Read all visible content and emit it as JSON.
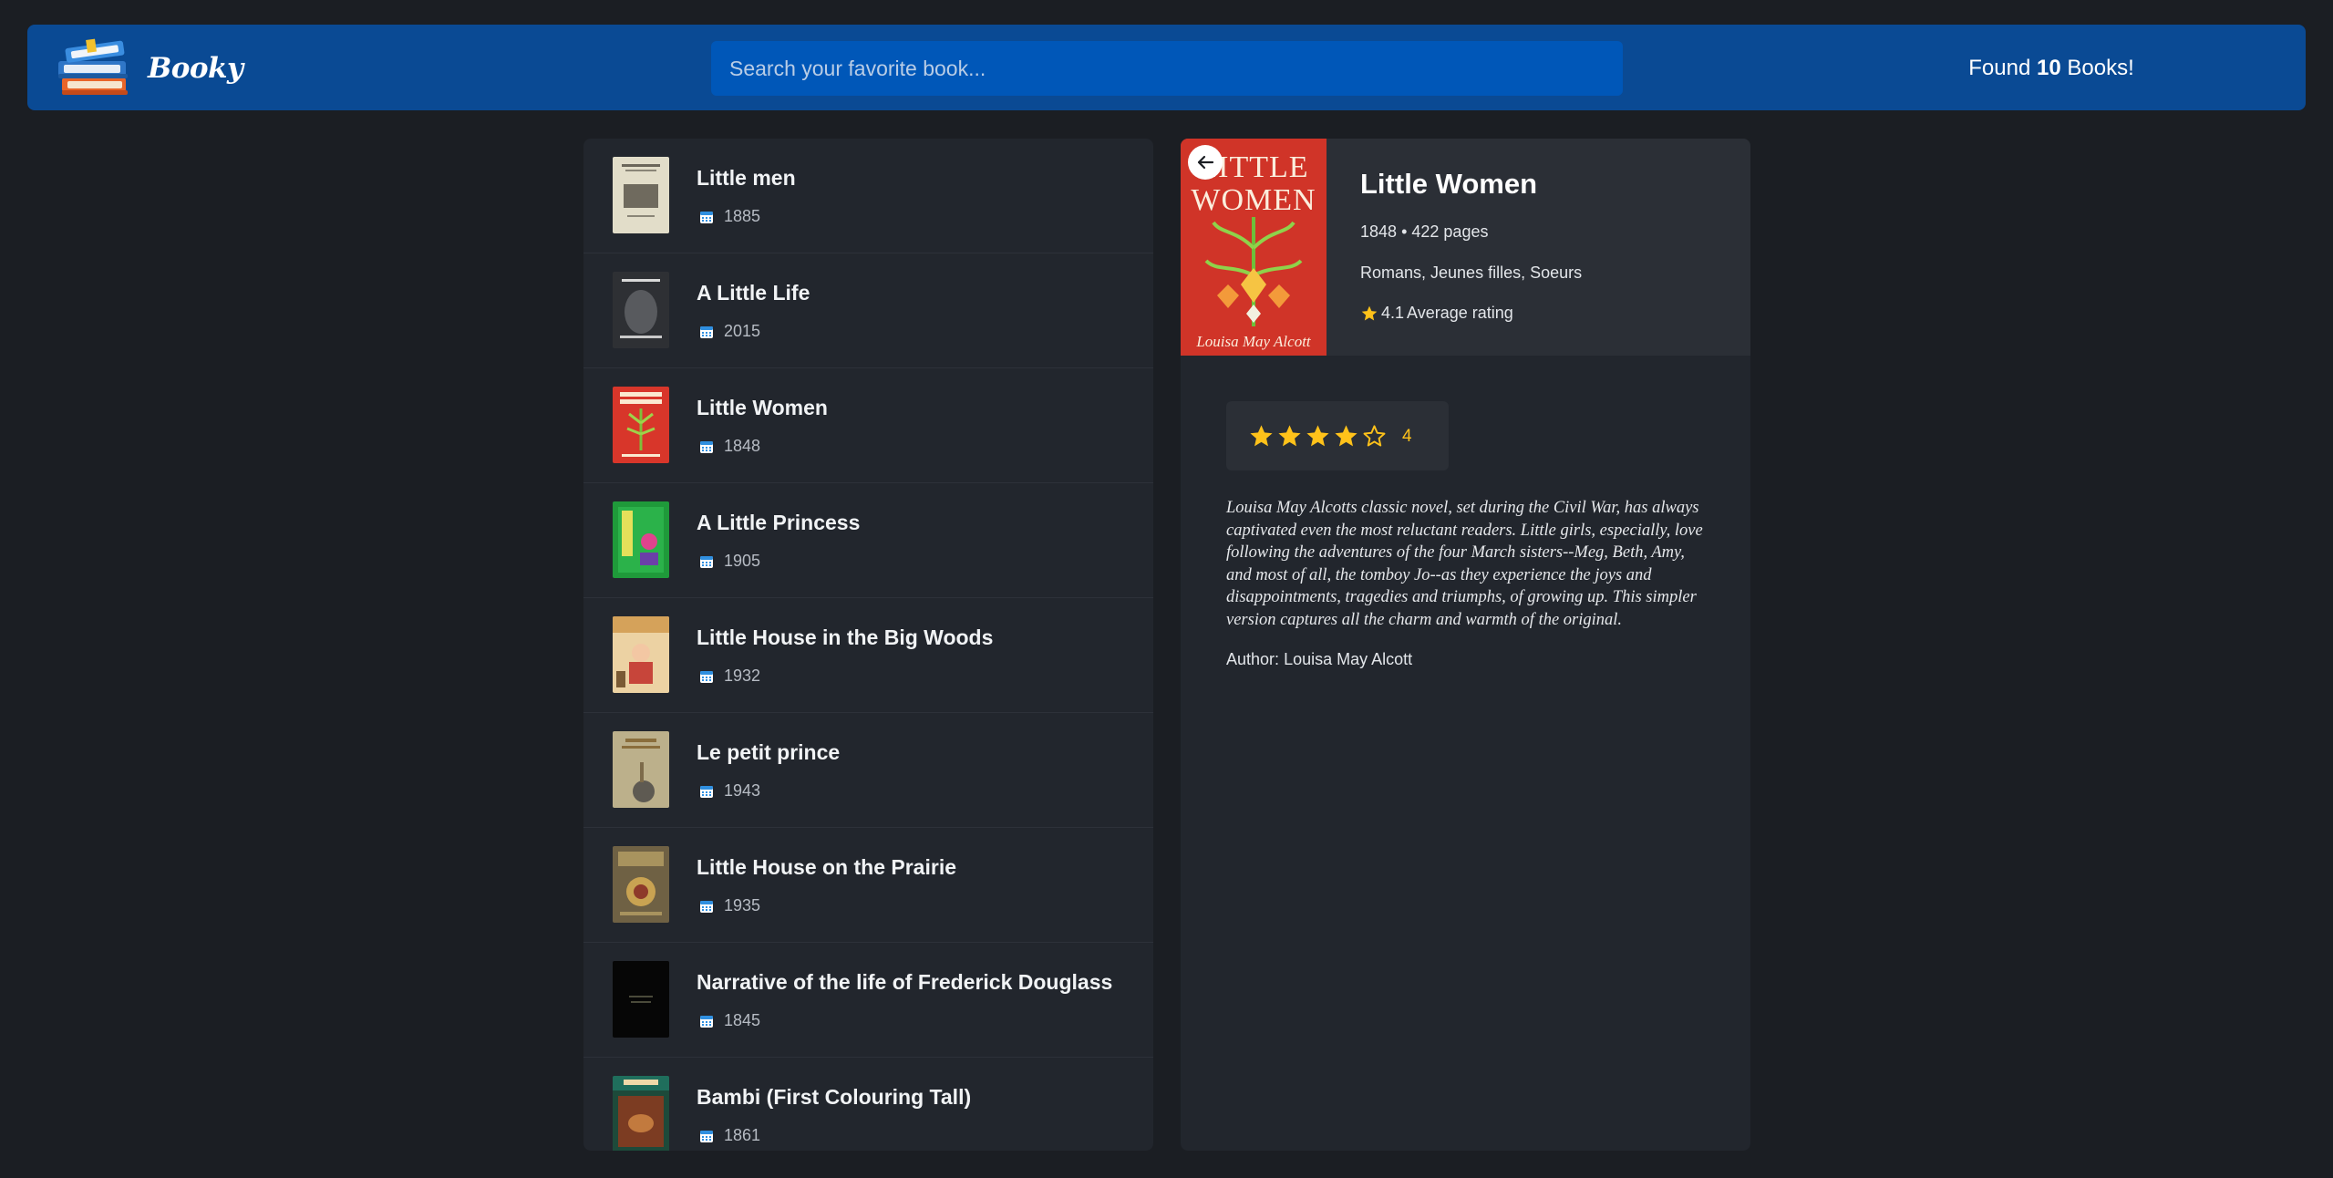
{
  "header": {
    "brand": "Booky",
    "search_placeholder": "Search your favorite book...",
    "found_prefix": "Found",
    "found_count": "10",
    "found_suffix": "Books!"
  },
  "books": [
    {
      "title": "Little men",
      "year": "1885",
      "cover": "#d8d3bf",
      "cover_text": "LITTLE MEN"
    },
    {
      "title": "A Little Life",
      "year": "2015",
      "cover": "#2d2f33",
      "cover_text": "A LITTLE LIFE"
    },
    {
      "title": "Little Women",
      "year": "1848",
      "cover": "#d8362a",
      "cover_text": "LITTLE WOMEN"
    },
    {
      "title": "A Little Princess",
      "year": "1905",
      "cover": "#1f9a3a",
      "cover_text": "A Little Princess"
    },
    {
      "title": "Little House in the Big Woods",
      "year": "1932",
      "cover": "#e8c99a",
      "cover_text": ""
    },
    {
      "title": "Le petit prince",
      "year": "1943",
      "cover": "#b7ab84",
      "cover_text": "Le Petit Prince"
    },
    {
      "title": "Little House on the Prairie",
      "year": "1935",
      "cover": "#7a6a48",
      "cover_text": "LITTLE HOUSE ON THE PRAIRIE"
    },
    {
      "title": "Narrative of the life of Frederick Douglass",
      "year": "1845",
      "cover": "#050505",
      "cover_text": ""
    },
    {
      "title": "Bambi (First Colouring Tall)",
      "year": "1861",
      "cover": "#1f4b3c",
      "cover_text": "BAMBI"
    }
  ],
  "detail": {
    "title": "Little Women",
    "year": "1848",
    "pages": "422 pages",
    "meta_sep": "•",
    "genres": "Romans, Jeunes filles, Soeurs",
    "average_rating": "4.1",
    "average_rating_label": "Average rating",
    "cover_title_1": "LITTLE",
    "cover_title_2": "WOMEN",
    "cover_author": "Louisa May Alcott",
    "user_rating": 4,
    "user_rating_max": 5,
    "user_rating_text": "4",
    "description": "Louisa May Alcotts classic novel, set during the Civil War, has always captivated even the most reluctant readers. Little girls, especially, love following the adventures of the four March sisters--Meg, Beth, Amy, and most of all, the tomboy Jo--as they experience the joys and disappointments, tragedies and triumphs, of growing up. This simpler version captures all the charm and warmth of the original.",
    "author_label": "Author:",
    "author": "Louisa May Alcott"
  },
  "colors": {
    "navbar": "#0a4a94",
    "search": "#0057b8",
    "star": "#ffc21a",
    "panel": "#22262d"
  },
  "icons": {
    "logo": "stack-of-books-icon",
    "year": "calendar-icon",
    "back": "arrow-left-icon",
    "rating": "star-icon"
  }
}
